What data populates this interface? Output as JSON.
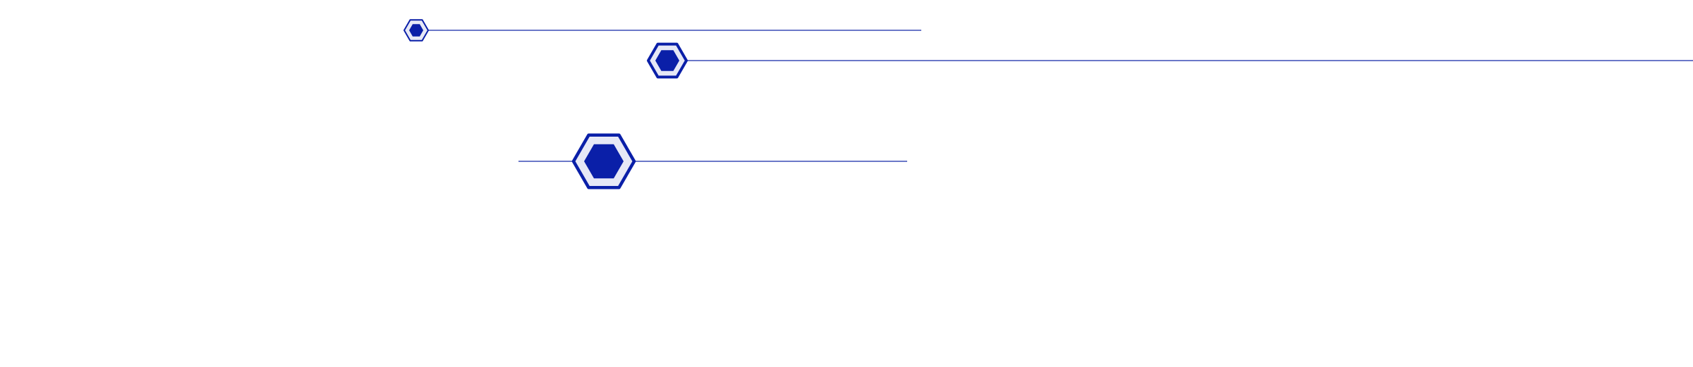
{
  "colors": {
    "background": "#ffffff",
    "accent": "#0a1fa8",
    "line": "#3a4bb5",
    "hex_fill": "#e6e8f6"
  },
  "elements": [
    {
      "name": "hexagon-marker-small",
      "icon": "hexagon-icon"
    },
    {
      "name": "hexagon-marker-medium",
      "icon": "hexagon-icon"
    },
    {
      "name": "hexagon-marker-large",
      "icon": "hexagon-icon"
    }
  ]
}
